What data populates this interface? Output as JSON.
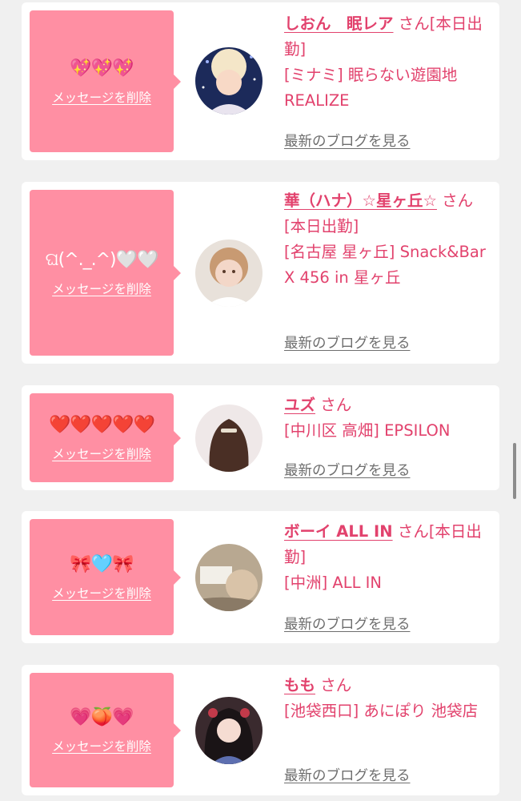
{
  "common": {
    "delete_label": "メッセージを削除",
    "blog_label": "最新のブログを見る",
    "honorific": "さん"
  },
  "colors": {
    "accent": "#e2426d",
    "stamp_bg": "#ff8fa3",
    "link_gray": "#6e6e6e",
    "page_bg": "#f0f0f0"
  },
  "messages": [
    {
      "emoji": "💖💖💖",
      "name": "しおん　眠レア",
      "status": "[本日出勤]",
      "shop": "[ミナミ] 眠らない遊園地REALIZE",
      "avatar_icon": "avatar-photo-icon"
    },
    {
      "emoji": "ଘ(^._.^)🤍🤍",
      "name": "華（ハナ）☆星ヶ丘☆",
      "status": "[本日出勤]",
      "shop": "[名古屋 星ヶ丘] Snack&Bar X 456 in 星ヶ丘",
      "avatar_icon": "avatar-photo-icon"
    },
    {
      "emoji": "❤️❤️❤️❤️❤️",
      "name": "ユズ",
      "status": "",
      "shop": "[中川区 高畑] EPSILON",
      "avatar_icon": "avatar-photo-icon"
    },
    {
      "emoji": "🎀🩵🎀",
      "name": "ボーイ ALL IN",
      "status": "[本日出勤]",
      "shop": "[中洲] ALL IN",
      "avatar_icon": "avatar-photo-icon"
    },
    {
      "emoji": "💗🍑💗",
      "name": "もも",
      "status": "",
      "shop": "[池袋西口] あにぽり 池袋店",
      "avatar_icon": "avatar-photo-icon"
    }
  ]
}
